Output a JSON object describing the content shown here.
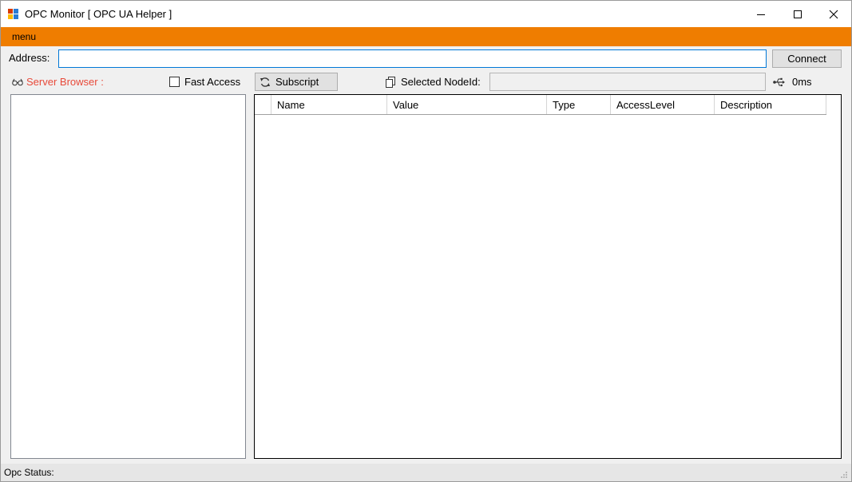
{
  "window": {
    "title": "OPC Monitor [ OPC UA Helper ]"
  },
  "menu": {
    "items": [
      "menu"
    ]
  },
  "address": {
    "label": "Address:",
    "value": "",
    "connect_label": "Connect"
  },
  "toolbar": {
    "server_browser_label": "Server Browser :",
    "fast_access_label": "Fast Access",
    "fast_access_checked": false,
    "subscript_label": "Subscript",
    "selected_nodeid_label": "Selected NodeId:",
    "selected_nodeid_value": "",
    "latency": "0ms"
  },
  "grid": {
    "columns": [
      "Name",
      "Value",
      "Type",
      "AccessLevel",
      "Description"
    ],
    "rows": []
  },
  "status": {
    "text": "Opc Status:"
  },
  "colors": {
    "menubar": "#ef7d00",
    "server_label": "#e84a3a",
    "input_focus_border": "#0078d7"
  },
  "icons": {
    "app": "app-icon",
    "server_browser": "glasses-icon",
    "subscript": "refresh-icon",
    "selected_node": "copy-icon",
    "latency": "usb-icon"
  }
}
